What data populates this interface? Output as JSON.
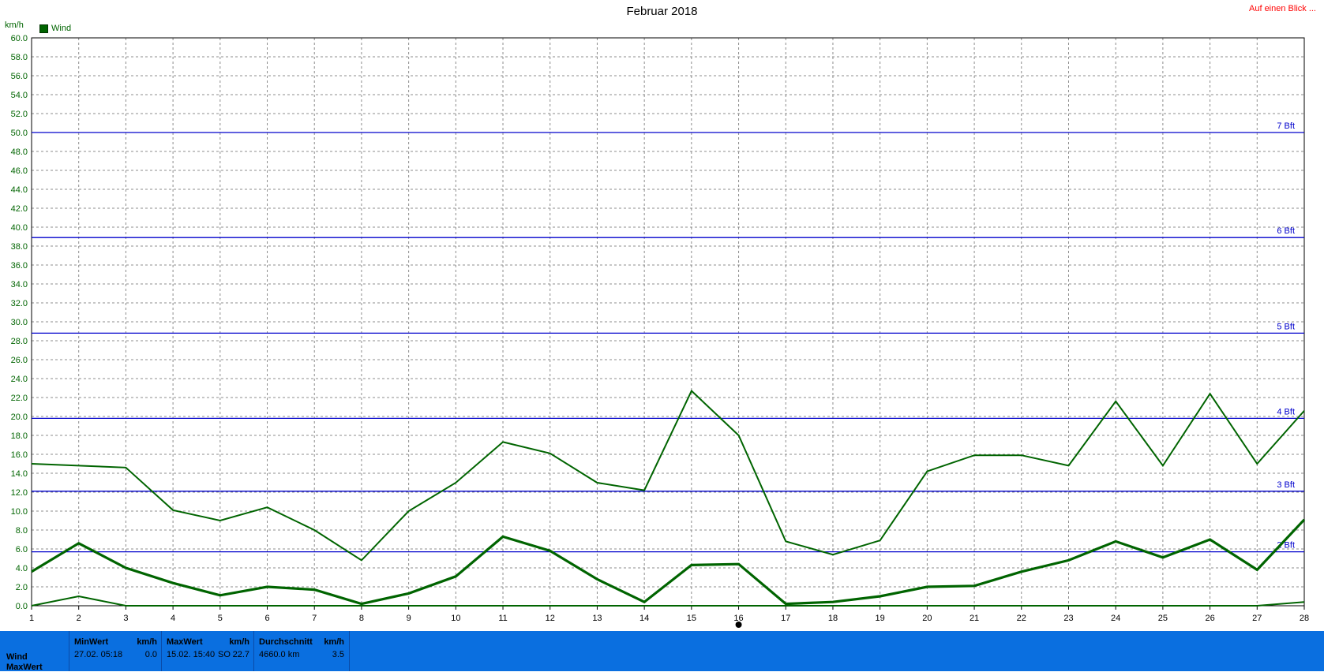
{
  "title": "Februar 2018",
  "link_text": "Auf einen Blick ...",
  "y_unit": "km/h",
  "legend_label": "Wind",
  "chart_data": {
    "type": "line",
    "x_ticks": [
      1,
      2,
      3,
      4,
      5,
      6,
      7,
      8,
      9,
      10,
      11,
      12,
      13,
      14,
      15,
      16,
      17,
      18,
      19,
      20,
      21,
      22,
      23,
      24,
      25,
      26,
      27,
      28
    ],
    "ylim": [
      0,
      60
    ],
    "y_ticks": [
      "0.0",
      "2.0",
      "4.0",
      "6.0",
      "8.0",
      "10.0",
      "12.0",
      "14.0",
      "16.0",
      "18.0",
      "20.0",
      "22.0",
      "24.0",
      "26.0",
      "28.0",
      "30.0",
      "32.0",
      "34.0",
      "36.0",
      "38.0",
      "40.0",
      "42.0",
      "44.0",
      "46.0",
      "48.0",
      "50.0",
      "52.0",
      "54.0",
      "56.0",
      "58.0",
      "60.0"
    ],
    "grid": true,
    "legend_position": "top-left",
    "series": [
      {
        "name": "Wind",
        "role": "max",
        "color": "#006400",
        "width": 2,
        "values": [
          15.0,
          14.8,
          14.6,
          10.1,
          9.0,
          10.4,
          8.0,
          4.8,
          10.0,
          13.0,
          17.3,
          16.1,
          13.0,
          12.2,
          22.7,
          18.0,
          6.8,
          5.4,
          6.9,
          14.2,
          15.9,
          15.9,
          14.8,
          21.6,
          14.8,
          22.4,
          15.0,
          20.6
        ]
      },
      {
        "name": "Wind",
        "role": "avg",
        "color": "#006400",
        "width": 3.2,
        "values": [
          3.6,
          6.6,
          4.0,
          2.4,
          1.1,
          2.0,
          1.7,
          0.2,
          1.3,
          3.1,
          7.3,
          5.8,
          2.8,
          0.4,
          4.3,
          4.4,
          0.2,
          0.4,
          1.0,
          2.0,
          2.1,
          3.6,
          4.8,
          6.8,
          5.1,
          7.0,
          3.8,
          9.1
        ]
      },
      {
        "name": "Wind",
        "role": "min",
        "color": "#006400",
        "width": 2,
        "values": [
          0.0,
          1.0,
          0.0,
          0.0,
          0.0,
          0.0,
          0.0,
          0.0,
          0.0,
          0.0,
          0.0,
          0.0,
          0.0,
          0.0,
          0.0,
          0.0,
          0.0,
          0.0,
          0.0,
          0.0,
          0.0,
          0.0,
          0.0,
          0.0,
          0.0,
          0.0,
          0.0,
          0.4
        ]
      }
    ],
    "reference_lines": [
      {
        "label": "2 Bft",
        "value": 5.7
      },
      {
        "label": "3 Bft",
        "value": 12.1
      },
      {
        "label": "4 Bft",
        "value": 19.8
      },
      {
        "label": "5 Bft",
        "value": 28.8
      },
      {
        "label": "6 Bft",
        "value": 38.9
      },
      {
        "label": "7 Bft",
        "value": 50.0
      }
    ],
    "reference_color": "#0000cc",
    "marker_day": 16
  },
  "summary": {
    "row_label_1": "Wind",
    "row_label_2": "MaxWert",
    "min": {
      "header": "MinWert",
      "unit": "km/h",
      "time": "27.02.  05:18",
      "value": "0.0"
    },
    "max": {
      "header": "MaxWert",
      "unit": "km/h",
      "time": "15.02.  15:40",
      "direction": "SO",
      "value": "22.7"
    },
    "avg": {
      "header": "Durchschnitt",
      "unit": "km/h",
      "distance": "4660.0 km",
      "value": "3.5"
    }
  }
}
